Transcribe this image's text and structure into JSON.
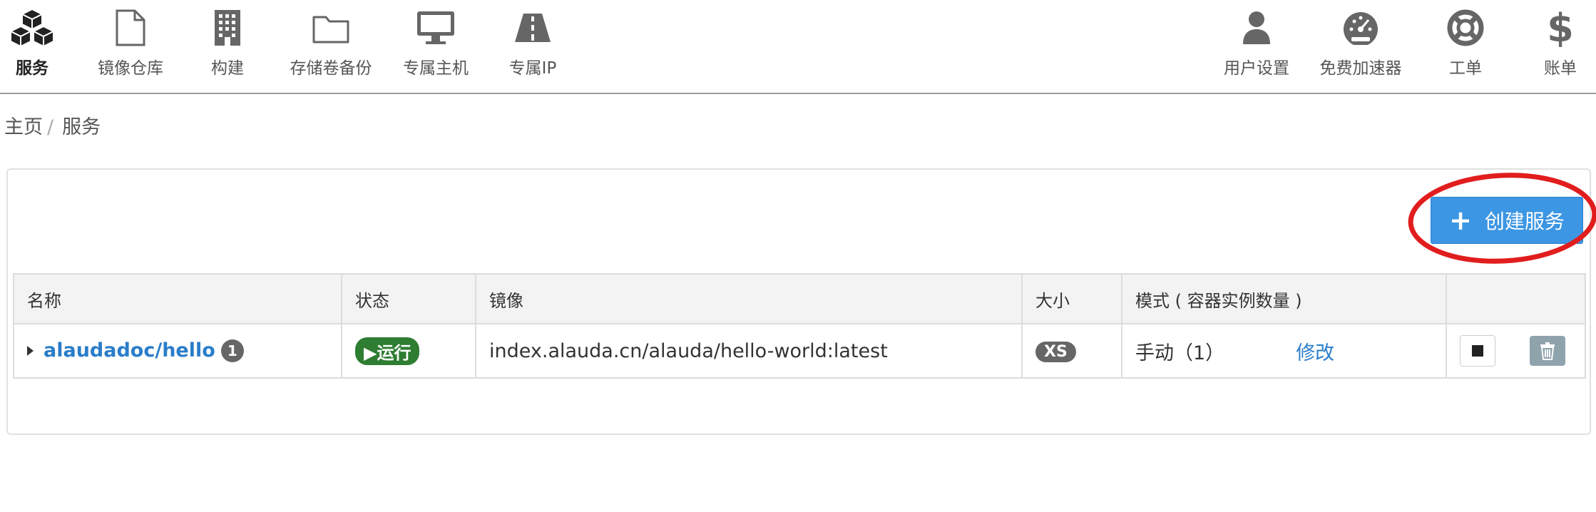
{
  "nav": {
    "left": [
      {
        "label": "服务",
        "icon": "cubes-icon",
        "active": true
      },
      {
        "label": "镜像仓库",
        "icon": "file-icon"
      },
      {
        "label": "构建",
        "icon": "building-icon"
      },
      {
        "label": "存储卷备份",
        "icon": "folder-icon"
      },
      {
        "label": "专属主机",
        "icon": "desktop-icon"
      },
      {
        "label": "专属IP",
        "icon": "road-icon"
      }
    ],
    "right": [
      {
        "label": "用户设置",
        "icon": "user-icon"
      },
      {
        "label": "免费加速器",
        "icon": "dashboard-icon"
      },
      {
        "label": "工单",
        "icon": "lifebuoy-icon"
      },
      {
        "label": "账单",
        "icon": "dollar-icon"
      }
    ]
  },
  "breadcrumb": {
    "home": "主页",
    "separator": "/",
    "current": "服务"
  },
  "create_button": {
    "label": "创建服务",
    "icon": "plus-icon"
  },
  "table": {
    "headers": [
      "名称",
      "状态",
      "镜像",
      "大小",
      "模式 ( 容器实例数量 )",
      ""
    ],
    "rows": [
      {
        "name": "alaudadoc/hello",
        "instances": "1",
        "status": "▶运行",
        "image": "index.alauda.cn/alauda/hello-world:latest",
        "size": "XS",
        "mode": "手动（1）",
        "edit": "修改"
      }
    ]
  },
  "colors": {
    "accent": "#3c96e3",
    "link": "#2a7dc9",
    "running": "#2e7d32",
    "highlight": "#e11d1d"
  }
}
